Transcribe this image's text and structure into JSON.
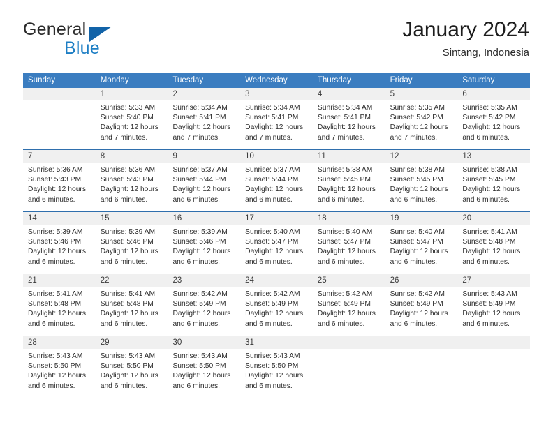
{
  "logo": {
    "word_one": "General",
    "word_two": "Blue",
    "triangle_color": "#1263a8",
    "blue_color": "#1d7ec4"
  },
  "header": {
    "title": "January 2024",
    "subtitle": "Sintang, Indonesia"
  },
  "colors": {
    "header_band": "#3b7dc0",
    "row_divider": "#2f6fad",
    "date_band": "#f0f0f0"
  },
  "weekdays": [
    "Sunday",
    "Monday",
    "Tuesday",
    "Wednesday",
    "Thursday",
    "Friday",
    "Saturday"
  ],
  "weeks": [
    [
      {
        "day": "",
        "sunrise": "",
        "sunset": "",
        "daylight_a": "",
        "daylight_b": ""
      },
      {
        "day": "1",
        "sunrise": "Sunrise: 5:33 AM",
        "sunset": "Sunset: 5:40 PM",
        "daylight_a": "Daylight: 12 hours",
        "daylight_b": "and 7 minutes."
      },
      {
        "day": "2",
        "sunrise": "Sunrise: 5:34 AM",
        "sunset": "Sunset: 5:41 PM",
        "daylight_a": "Daylight: 12 hours",
        "daylight_b": "and 7 minutes."
      },
      {
        "day": "3",
        "sunrise": "Sunrise: 5:34 AM",
        "sunset": "Sunset: 5:41 PM",
        "daylight_a": "Daylight: 12 hours",
        "daylight_b": "and 7 minutes."
      },
      {
        "day": "4",
        "sunrise": "Sunrise: 5:34 AM",
        "sunset": "Sunset: 5:41 PM",
        "daylight_a": "Daylight: 12 hours",
        "daylight_b": "and 7 minutes."
      },
      {
        "day": "5",
        "sunrise": "Sunrise: 5:35 AM",
        "sunset": "Sunset: 5:42 PM",
        "daylight_a": "Daylight: 12 hours",
        "daylight_b": "and 7 minutes."
      },
      {
        "day": "6",
        "sunrise": "Sunrise: 5:35 AM",
        "sunset": "Sunset: 5:42 PM",
        "daylight_a": "Daylight: 12 hours",
        "daylight_b": "and 6 minutes."
      }
    ],
    [
      {
        "day": "7",
        "sunrise": "Sunrise: 5:36 AM",
        "sunset": "Sunset: 5:43 PM",
        "daylight_a": "Daylight: 12 hours",
        "daylight_b": "and 6 minutes."
      },
      {
        "day": "8",
        "sunrise": "Sunrise: 5:36 AM",
        "sunset": "Sunset: 5:43 PM",
        "daylight_a": "Daylight: 12 hours",
        "daylight_b": "and 6 minutes."
      },
      {
        "day": "9",
        "sunrise": "Sunrise: 5:37 AM",
        "sunset": "Sunset: 5:44 PM",
        "daylight_a": "Daylight: 12 hours",
        "daylight_b": "and 6 minutes."
      },
      {
        "day": "10",
        "sunrise": "Sunrise: 5:37 AM",
        "sunset": "Sunset: 5:44 PM",
        "daylight_a": "Daylight: 12 hours",
        "daylight_b": "and 6 minutes."
      },
      {
        "day": "11",
        "sunrise": "Sunrise: 5:38 AM",
        "sunset": "Sunset: 5:45 PM",
        "daylight_a": "Daylight: 12 hours",
        "daylight_b": "and 6 minutes."
      },
      {
        "day": "12",
        "sunrise": "Sunrise: 5:38 AM",
        "sunset": "Sunset: 5:45 PM",
        "daylight_a": "Daylight: 12 hours",
        "daylight_b": "and 6 minutes."
      },
      {
        "day": "13",
        "sunrise": "Sunrise: 5:38 AM",
        "sunset": "Sunset: 5:45 PM",
        "daylight_a": "Daylight: 12 hours",
        "daylight_b": "and 6 minutes."
      }
    ],
    [
      {
        "day": "14",
        "sunrise": "Sunrise: 5:39 AM",
        "sunset": "Sunset: 5:46 PM",
        "daylight_a": "Daylight: 12 hours",
        "daylight_b": "and 6 minutes."
      },
      {
        "day": "15",
        "sunrise": "Sunrise: 5:39 AM",
        "sunset": "Sunset: 5:46 PM",
        "daylight_a": "Daylight: 12 hours",
        "daylight_b": "and 6 minutes."
      },
      {
        "day": "16",
        "sunrise": "Sunrise: 5:39 AM",
        "sunset": "Sunset: 5:46 PM",
        "daylight_a": "Daylight: 12 hours",
        "daylight_b": "and 6 minutes."
      },
      {
        "day": "17",
        "sunrise": "Sunrise: 5:40 AM",
        "sunset": "Sunset: 5:47 PM",
        "daylight_a": "Daylight: 12 hours",
        "daylight_b": "and 6 minutes."
      },
      {
        "day": "18",
        "sunrise": "Sunrise: 5:40 AM",
        "sunset": "Sunset: 5:47 PM",
        "daylight_a": "Daylight: 12 hours",
        "daylight_b": "and 6 minutes."
      },
      {
        "day": "19",
        "sunrise": "Sunrise: 5:40 AM",
        "sunset": "Sunset: 5:47 PM",
        "daylight_a": "Daylight: 12 hours",
        "daylight_b": "and 6 minutes."
      },
      {
        "day": "20",
        "sunrise": "Sunrise: 5:41 AM",
        "sunset": "Sunset: 5:48 PM",
        "daylight_a": "Daylight: 12 hours",
        "daylight_b": "and 6 minutes."
      }
    ],
    [
      {
        "day": "21",
        "sunrise": "Sunrise: 5:41 AM",
        "sunset": "Sunset: 5:48 PM",
        "daylight_a": "Daylight: 12 hours",
        "daylight_b": "and 6 minutes."
      },
      {
        "day": "22",
        "sunrise": "Sunrise: 5:41 AM",
        "sunset": "Sunset: 5:48 PM",
        "daylight_a": "Daylight: 12 hours",
        "daylight_b": "and 6 minutes."
      },
      {
        "day": "23",
        "sunrise": "Sunrise: 5:42 AM",
        "sunset": "Sunset: 5:49 PM",
        "daylight_a": "Daylight: 12 hours",
        "daylight_b": "and 6 minutes."
      },
      {
        "day": "24",
        "sunrise": "Sunrise: 5:42 AM",
        "sunset": "Sunset: 5:49 PM",
        "daylight_a": "Daylight: 12 hours",
        "daylight_b": "and 6 minutes."
      },
      {
        "day": "25",
        "sunrise": "Sunrise: 5:42 AM",
        "sunset": "Sunset: 5:49 PM",
        "daylight_a": "Daylight: 12 hours",
        "daylight_b": "and 6 minutes."
      },
      {
        "day": "26",
        "sunrise": "Sunrise: 5:42 AM",
        "sunset": "Sunset: 5:49 PM",
        "daylight_a": "Daylight: 12 hours",
        "daylight_b": "and 6 minutes."
      },
      {
        "day": "27",
        "sunrise": "Sunrise: 5:43 AM",
        "sunset": "Sunset: 5:49 PM",
        "daylight_a": "Daylight: 12 hours",
        "daylight_b": "and 6 minutes."
      }
    ],
    [
      {
        "day": "28",
        "sunrise": "Sunrise: 5:43 AM",
        "sunset": "Sunset: 5:50 PM",
        "daylight_a": "Daylight: 12 hours",
        "daylight_b": "and 6 minutes."
      },
      {
        "day": "29",
        "sunrise": "Sunrise: 5:43 AM",
        "sunset": "Sunset: 5:50 PM",
        "daylight_a": "Daylight: 12 hours",
        "daylight_b": "and 6 minutes."
      },
      {
        "day": "30",
        "sunrise": "Sunrise: 5:43 AM",
        "sunset": "Sunset: 5:50 PM",
        "daylight_a": "Daylight: 12 hours",
        "daylight_b": "and 6 minutes."
      },
      {
        "day": "31",
        "sunrise": "Sunrise: 5:43 AM",
        "sunset": "Sunset: 5:50 PM",
        "daylight_a": "Daylight: 12 hours",
        "daylight_b": "and 6 minutes."
      },
      {
        "day": "",
        "sunrise": "",
        "sunset": "",
        "daylight_a": "",
        "daylight_b": ""
      },
      {
        "day": "",
        "sunrise": "",
        "sunset": "",
        "daylight_a": "",
        "daylight_b": ""
      },
      {
        "day": "",
        "sunrise": "",
        "sunset": "",
        "daylight_a": "",
        "daylight_b": ""
      }
    ]
  ]
}
